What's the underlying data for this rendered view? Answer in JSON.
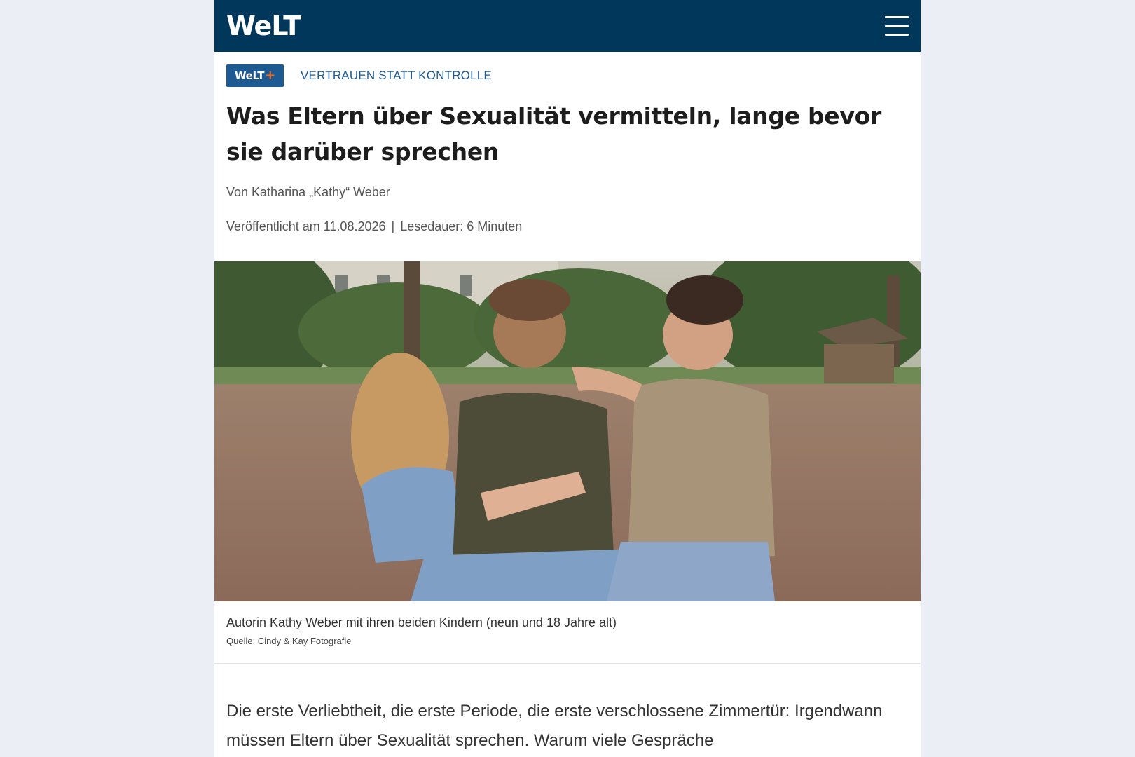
{
  "header": {
    "logo": "WeLT",
    "menu_icon": "hamburger-menu-icon"
  },
  "article": {
    "badge": {
      "text": "WeLT",
      "plus": "+",
      "color": "#1d5a92",
      "plus_color": "#f06a21"
    },
    "kicker": "VERTRAUEN STATT KONTROLLE",
    "headline": "Was Eltern über Sexualität vermitteln, lange bevor sie darüber sprechen",
    "author": "Von Katharina „Kathy“ Weber",
    "published": "Veröffentlicht am 11.08.2026",
    "separator": "|",
    "reading_time": "Lesedauer: 6 Minuten",
    "image": {
      "caption": "Autorin Kathy Weber mit ihren beiden Kindern (neun und 18 Jahre alt)",
      "source": "Quelle: Cindy & Kay Fotografie"
    },
    "body_text": "Die erste Verliebtheit, die erste Periode, die erste verschlossene Zimmertür: Irgendwann müssen Eltern über Sexualität sprechen. Warum viele Gespräche"
  },
  "colors": {
    "header_bg": "#00375b",
    "accent": "#1d5a92",
    "page_bg": "#eceef6"
  }
}
